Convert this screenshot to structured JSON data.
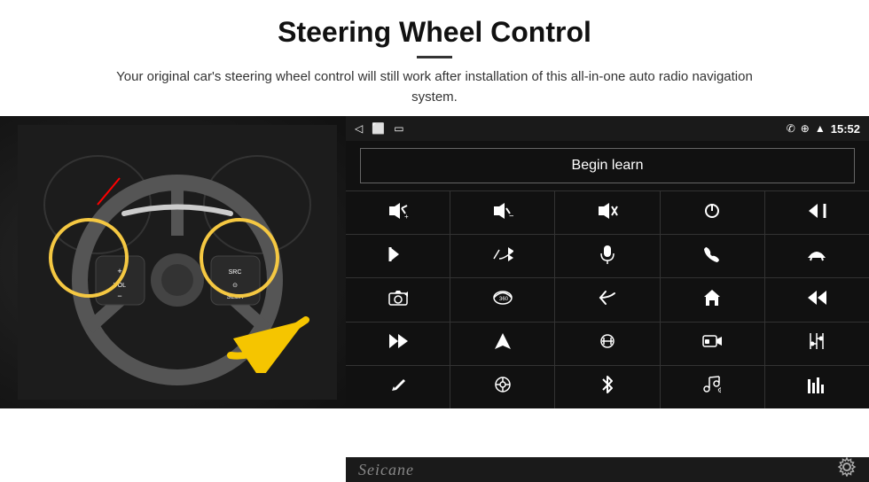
{
  "header": {
    "title": "Steering Wheel Control",
    "subtitle": "Your original car's steering wheel control will still work after installation of this all-in-one auto radio navigation system."
  },
  "status_bar": {
    "back_icon": "◁",
    "home_icon": "⬜",
    "recent_icon": "▭",
    "phone_icon": "✆",
    "location_icon": "⊕",
    "signal_icon": "▲",
    "time": "15:52"
  },
  "begin_learn": {
    "label": "Begin learn"
  },
  "controls": [
    {
      "icon": "🔊+",
      "symbol": "vol+"
    },
    {
      "icon": "🔊−",
      "symbol": "vol-"
    },
    {
      "icon": "🔇",
      "symbol": "mute"
    },
    {
      "icon": "⏻",
      "symbol": "power"
    },
    {
      "icon": "⏮",
      "symbol": "prev-track"
    },
    {
      "icon": "⏭",
      "symbol": "next"
    },
    {
      "icon": "✂⏭",
      "symbol": "ff"
    },
    {
      "icon": "🎤",
      "symbol": "mic"
    },
    {
      "icon": "📞",
      "symbol": "call"
    },
    {
      "icon": "📵",
      "symbol": "end-call"
    },
    {
      "icon": "📢",
      "symbol": "horn"
    },
    {
      "icon": "360",
      "symbol": "360"
    },
    {
      "icon": "↩",
      "symbol": "back"
    },
    {
      "icon": "🏠",
      "symbol": "home"
    },
    {
      "icon": "⏮⏮",
      "symbol": "rew"
    },
    {
      "icon": "⏭⏭",
      "symbol": "fwd"
    },
    {
      "icon": "▶",
      "symbol": "nav"
    },
    {
      "icon": "⇌",
      "symbol": "switch"
    },
    {
      "icon": "📷",
      "symbol": "cam"
    },
    {
      "icon": "⚙",
      "symbol": "settings"
    },
    {
      "icon": "✏",
      "symbol": "pen"
    },
    {
      "icon": "⊙",
      "symbol": "menu"
    },
    {
      "icon": "✱",
      "symbol": "bt"
    },
    {
      "icon": "♪",
      "symbol": "music"
    },
    {
      "icon": "📶",
      "symbol": "eq"
    }
  ],
  "watermark": {
    "brand": "Seicane"
  }
}
